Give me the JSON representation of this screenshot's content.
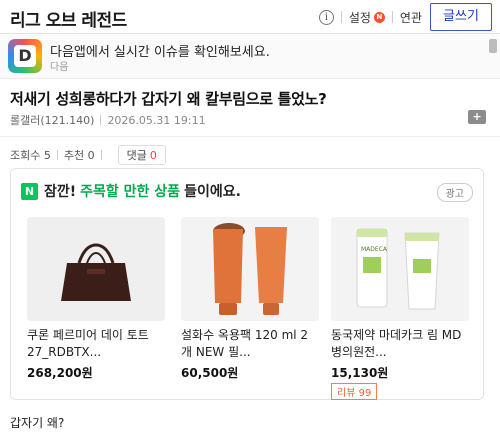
{
  "header": {
    "brand": "리그 오브 레전드",
    "info_icon_glyph": "i",
    "settings_label": "설정",
    "settings_badge": "N",
    "related_label": "연관",
    "write_button": "글쓰기"
  },
  "banner": {
    "logo_letter": "D",
    "text": "다음앱에서 실시간 이슈를 확인해보세요.",
    "sub": "다음"
  },
  "post": {
    "title": "저새기 성희롱하다가 갑자기 왜 칼부림으로 틀었노?",
    "author": "롤갤러(121.140)",
    "date": "2026.05.31 19:11",
    "views_label": "조회수 5",
    "recommend_label": "추천 0",
    "comments_label": "댓글",
    "comments_count": "0"
  },
  "ad": {
    "n_logo": "N",
    "head_prefix": "잠깐!",
    "head_highlight": "주목할 만한 상품",
    "head_suffix": "들이에요.",
    "tag": "광고",
    "products": [
      {
        "name": "쿠론 페르미어 데이 토트 27_RDBTX...",
        "price": "268,200원",
        "review": ""
      },
      {
        "name": "설화수 옥용팩 120 ml 2개 NEW 필...",
        "price": "60,500원",
        "review": ""
      },
      {
        "name": "동국제약 마데카크 림 MD 병의원전...",
        "price": "15,130원",
        "review": "리뷰 99"
      }
    ],
    "product3_label": "MADECA"
  },
  "footer": {
    "text": "갑자기 왜?"
  },
  "colors": {
    "accent_blue": "#1d3bbf",
    "naver_green": "#03c75a",
    "alert_red": "#ff3b30"
  }
}
